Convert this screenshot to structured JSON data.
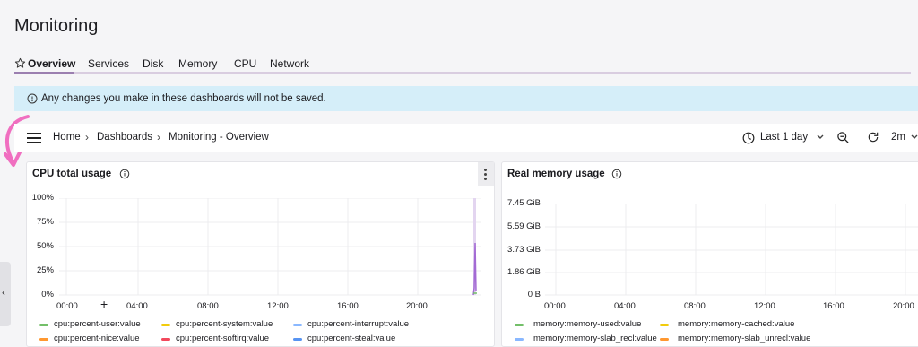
{
  "page": {
    "title": "Monitoring"
  },
  "tabs": [
    {
      "label": "Overview",
      "active": true,
      "icon": "star-icon"
    },
    {
      "label": "Services"
    },
    {
      "label": "Disk"
    },
    {
      "label": "Memory"
    },
    {
      "label": "CPU"
    },
    {
      "label": "Network"
    }
  ],
  "banner": {
    "text": "Any changes you make in these dashboards will not be saved.",
    "icon": "info-icon",
    "color": "#d5eef9"
  },
  "dashboard_bar": {
    "breadcrumb": [
      "Home",
      "Dashboards",
      "Monitoring - Overview"
    ],
    "separator": "›",
    "time_range": "Last 1 day",
    "refresh": "2m"
  },
  "side_tab": {
    "glyph": "‹"
  },
  "panels": [
    {
      "title": "CPU total usage",
      "y_ticks": [
        "100%",
        "75%",
        "50%",
        "25%",
        "0%"
      ],
      "x_ticks": [
        "00:00",
        "04:00",
        "08:00",
        "12:00",
        "16:00",
        "20:00"
      ],
      "cursor": "+",
      "legend": [
        {
          "label": "cpu:percent-user:value",
          "color": "#73bf69"
        },
        {
          "label": "cpu:percent-system:value",
          "color": "#f2cc0c"
        },
        {
          "label": "cpu:percent-interrupt:value",
          "color": "#8ab8ff"
        },
        {
          "label": "cpu:percent-nice:value",
          "color": "#ff9830"
        },
        {
          "label": "cpu:percent-softirq:value",
          "color": "#f2495c"
        },
        {
          "label": "cpu:percent-steal:value",
          "color": "#5794f2"
        }
      ]
    },
    {
      "title": "Real memory usage",
      "y_ticks": [
        "7.45 GiB",
        "5.59 GiB",
        "3.73 GiB",
        "1.86 GiB",
        "0 B"
      ],
      "x_ticks": [
        "00:00",
        "04:00",
        "08:00",
        "12:00",
        "16:00",
        "20:00"
      ],
      "legend": [
        {
          "label": "memory:memory-used:value",
          "color": "#73bf69"
        },
        {
          "label": "memory:memory-cached:value",
          "color": "#f2cc0c"
        },
        {
          "label": "memory:memory-slab_recl:value",
          "color": "#8ab8ff"
        },
        {
          "label": "memory:memory-slab_unrecl:value",
          "color": "#ff9830"
        }
      ]
    }
  ],
  "colors": {
    "accent": "#9b7fb0",
    "annotation": "#f06fc0",
    "purple_series": "#a36ad4"
  }
}
